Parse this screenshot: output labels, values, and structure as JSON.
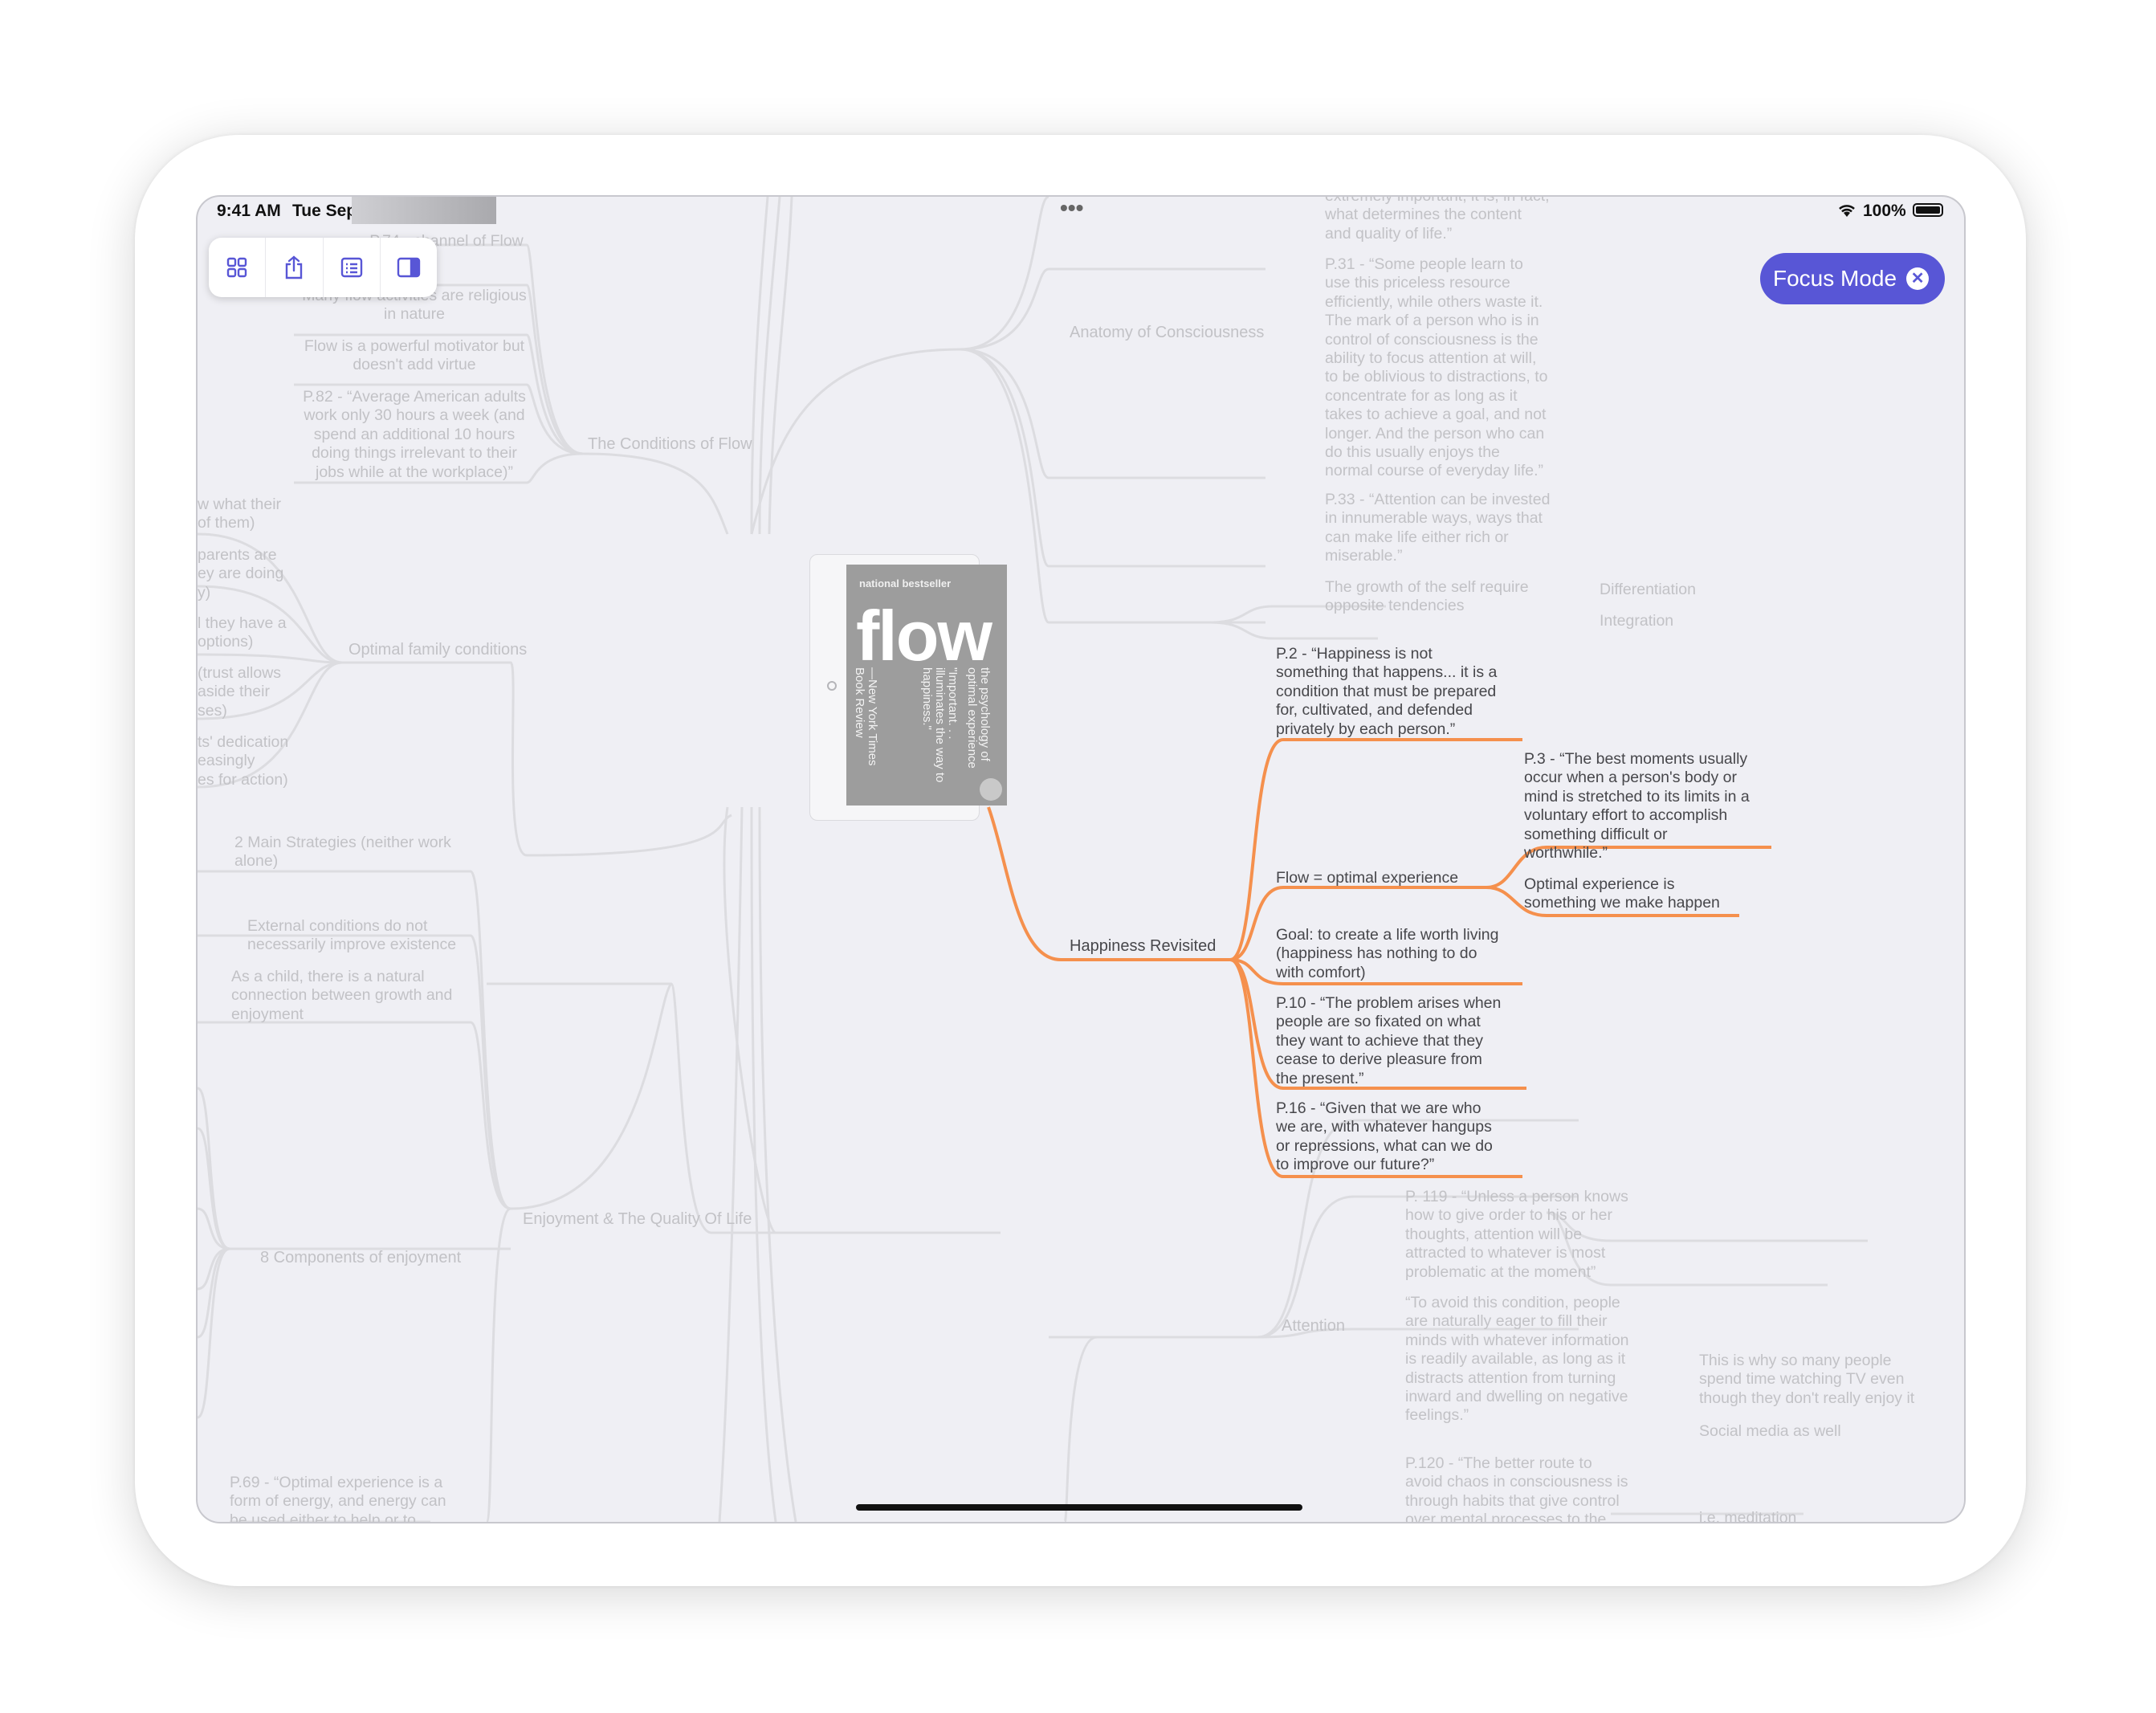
{
  "status_bar": {
    "time": "9:41 AM",
    "date": "Tue Sep 15",
    "battery": "100%",
    "dots": "•••"
  },
  "toolbar": {
    "buttons": [
      {
        "icon": "grid-icon"
      },
      {
        "icon": "share-icon"
      },
      {
        "icon": "outline-icon"
      },
      {
        "icon": "sidebar-icon"
      }
    ]
  },
  "focus_mode": {
    "label": "Focus Mode",
    "close_icon": "close-icon",
    "color": "#5856d6"
  },
  "colors": {
    "highlight": "#f5904d",
    "branch": "#d9d9dd",
    "canvas": "#efeff4"
  },
  "book": {
    "tag": "national bestseller",
    "title": "flow",
    "subtitle": "the psychology of optimal experience",
    "quote": "\"Important. . . illuminates the way to happiness.\"",
    "source": "—New York Times Book Review"
  },
  "nodes": {
    "conditions_of_flow": "The Conditions of Flow",
    "p74": "P.74 - channel of Flow",
    "religious": "Many flow activities are religious\nin nature",
    "motivator": "Flow is a powerful motivator but\ndoesn't add virtue",
    "p82": "P.82 - “Average American adults\nwork only 30 hours a week (and\nspend an additional 10 hours\ndoing things irrelevant to their\njobs while at the workplace)”",
    "optimal_family": "Optimal family conditions",
    "fam1": "w what their\nof them)",
    "fam2": "parents are\ney are doing\ny)",
    "fam3": "l they have a\noptions)",
    "fam4": "(trust allows\naside their\nses)",
    "fam5": "ts' dedication\neasingly\nes for action)",
    "enjoyment": "Enjoyment & The Quality Of Life",
    "two_strategies": "2 Main Strategies (neither work\nalone)",
    "external": "External conditions do not\nnecessarily improve existence",
    "child": "As a child, there is a natural\nconnection between growth and\nenjoyment",
    "eight_components": "8 Components of enjoyment",
    "p69": "P.69 - “Optimal experience is a\nform of energy, and energy can\nbe used either to help or to",
    "anatomy": "Anatomy of Consciousness",
    "extremely": "extremely important, it is, in fact,\nwhat determines the content\nand quality of life.”",
    "p31": "P.31 - “Some people learn to\nuse this priceless resource\nefficiently, while others waste it.\nThe mark of a person who is in\ncontrol of consciousness is the\nability to focus attention at will,\nto be oblivious to distractions, to\nconcentrate for as long as it\ntakes to achieve a goal, and not\nlonger. And the person who can\ndo this usually enjoys the\nnormal course of everyday life.”",
    "p33": "P.33 - “Attention can be invested\nin innumerable ways, ways that\ncan make life either rich or\nmiserable.”",
    "growth": "The growth of the self require\nopposite tendencies",
    "differentiation": "Differentiation",
    "integration": "Integration",
    "happiness": "Happiness Revisited",
    "p2": "P.2 - “Happiness is not\nsomething that happens... it is a\ncondition that must be prepared\nfor, cultivated, and defended\nprivately by each person.”",
    "flow_optimal": "Flow = optimal experience",
    "p3": "P.3 - “The best moments usually\noccur when a person's body or\nmind is stretched to its limits in a\nvoluntary effort to accomplish\nsomething difficult or\nworthwhile.”",
    "optimal_make": "Optimal experience is\nsomething we make happen",
    "goal": "Goal: to create a life worth living\n(happiness has nothing to do\nwith comfort)",
    "p10": "P.10 - “The problem arises when\npeople are so fixated on what\nthey want to achieve that they\ncease to derive pleasure from\nthe present.”",
    "p16": "P.16 - “Given that we are who\nwe are, with whatever hangups\nor repressions, what can we do\nto improve our future?”",
    "attention": "Attention",
    "p119": "P. 119 - “Unless a person knows\nhow to give order to his or her\nthoughts, attention will be\nattracted to whatever is most\nproblematic at the moment”",
    "avoid": "“To avoid this condition, people\nare naturally eager to fill their\nminds with whatever information\nis readily available, as long as it\ndistracts attention from turning\ninward and dwelling on negative\nfeelings.”",
    "tv": "This is why so many people\nspend time watching TV even\nthough they don't really enjoy it",
    "social": "Social media as well",
    "p120": "P.120 - “The better route to\navoid chaos in consciousness is\nthrough habits that give control\nover mental processes to the",
    "meditation": "i.e. meditation"
  }
}
